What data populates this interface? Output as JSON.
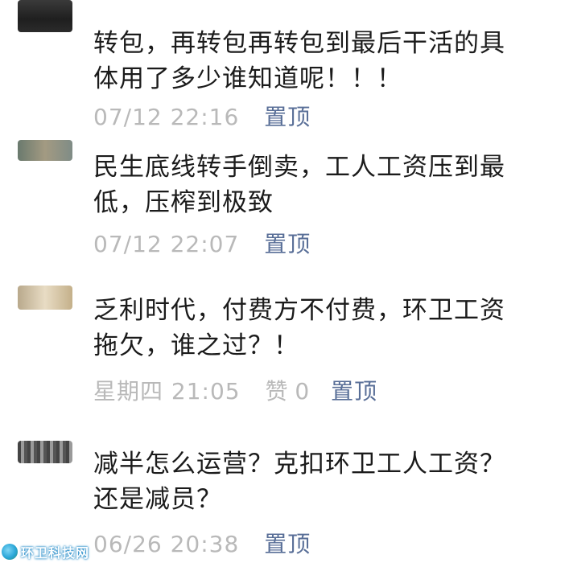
{
  "comments": [
    {
      "text_line1": "转包，再转包再转包到最后干活的具",
      "text_line2": "体用了多少谁知道呢！！！",
      "time": "07/12 22:16",
      "pin_label": "置顶"
    },
    {
      "text_line1": "民生底线转手倒卖，工人工资压到最",
      "text_line2": "低，压榨到极致",
      "time": "07/12 22:07",
      "pin_label": "置顶"
    },
    {
      "text_line1": "乏利时代，付费方不付费，环卫工资",
      "text_line2": "拖欠，谁之过？！",
      "time": "星期四 21:05",
      "likes": "赞 0",
      "pin_label": "置顶"
    },
    {
      "text_line1": "减半怎么运营？克扣环卫工人工资？",
      "text_line2": "还是减员？",
      "time": "06/26 20:38",
      "pin_label": "置顶"
    }
  ],
  "watermark": {
    "text": "环卫科技网"
  },
  "colors": {
    "meta_gray": "#b9b9b9",
    "pin_blue": "#586e97",
    "text": "#1b1b1b"
  }
}
